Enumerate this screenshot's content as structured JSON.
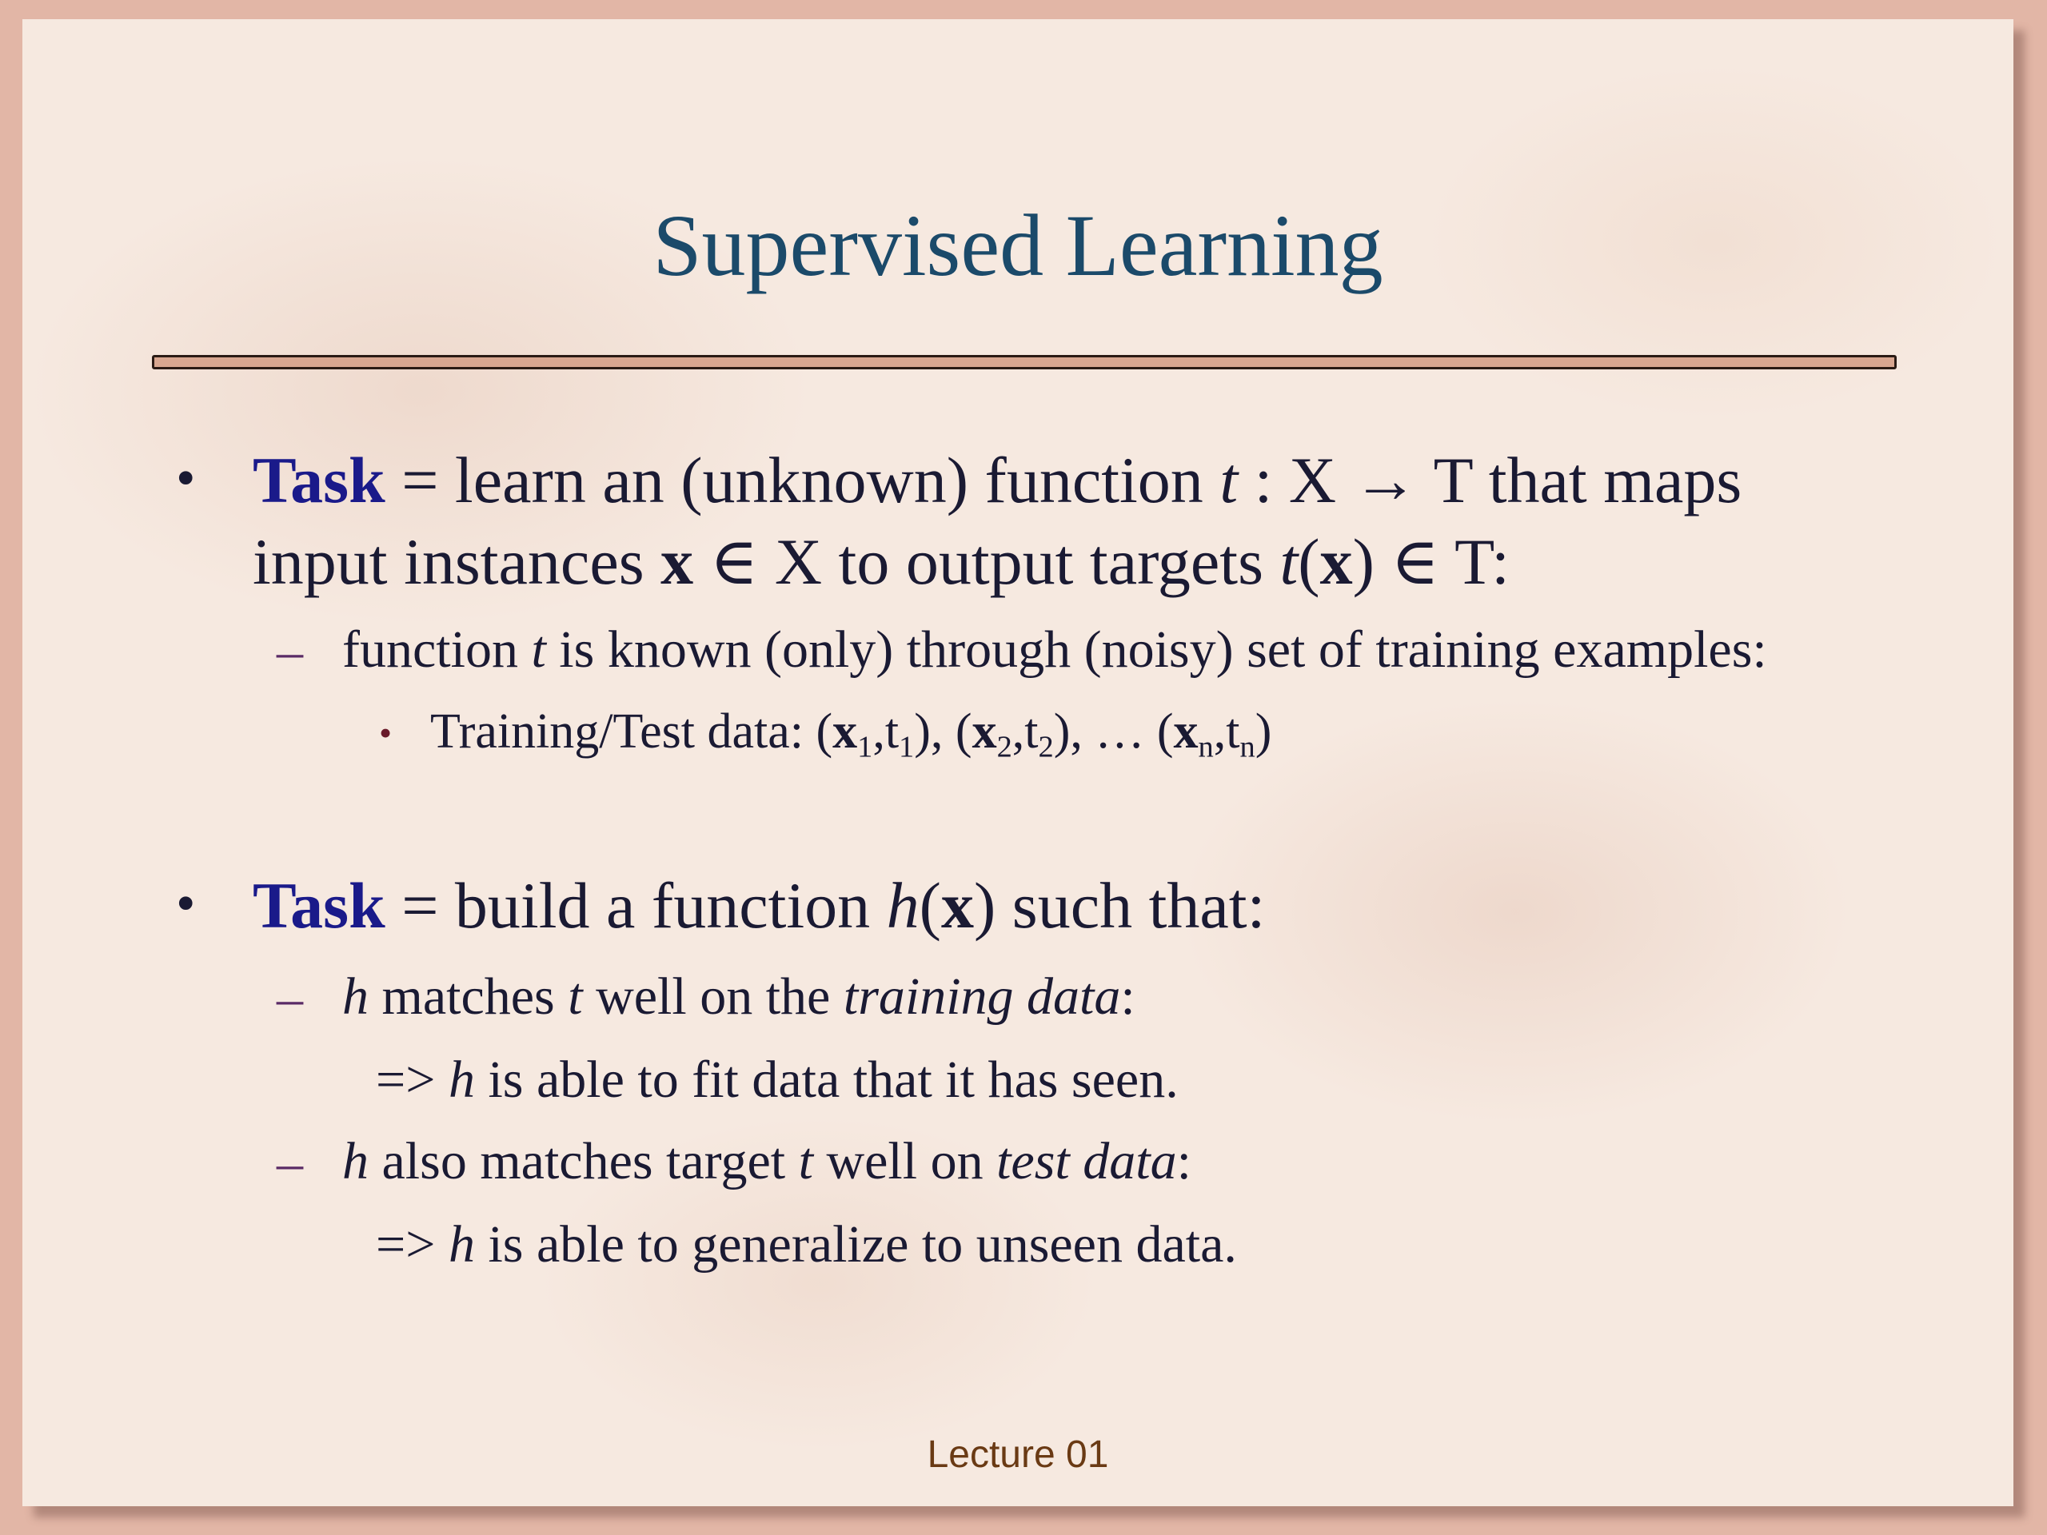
{
  "slide": {
    "title": "Supervised Learning",
    "footer": "Lecture 01",
    "bullet_glyph": "•",
    "dash_glyph": "–",
    "small_bullet_glyph": "•",
    "block1": {
      "keyword": "Task",
      "l1_a": " = learn an (unknown) function ",
      "l1_t": "t",
      "l1_b": " : X ",
      "arrow": "→",
      "l1_c": " T that maps",
      "l2_a": "input instances ",
      "l2_x": "x",
      "l2_in1": " ∈ ",
      "l2_b": "X to output targets ",
      "l2_t": "t",
      "l2_paren_open": "(",
      "l2_x2": "x",
      "l2_paren_close": ")",
      "l2_in2": " ∈ ",
      "l2_c": "T:",
      "sub1_a": "function ",
      "sub1_t": "t",
      "sub1_b": "  is known (only) through (noisy) set of training examples:",
      "sub2_a": "Training/Test data: (",
      "x": "x",
      "s1": "1",
      "comma_t": ",t",
      "s1b": "1",
      "mid1": "), (",
      "s2": "2",
      "s2b": "2",
      "mid2": "), … (",
      "sn": "n",
      "snb": "n",
      "end": ")"
    },
    "block2": {
      "keyword": "Task",
      "l1_a": " = build a function ",
      "l1_h": "h",
      "l1_po": "(",
      "l1_x": "x",
      "l1_pc": ")",
      "l1_b": " such that:",
      "d1_h": "h",
      "d1_a": " matches ",
      "d1_t": "t",
      "d1_b": " well on the ",
      "d1_td": "training data",
      "d1_c": ":",
      "r1_a": "=> ",
      "r1_h": "h",
      "r1_b": " is able to fit data that it has seen.",
      "d2_h": "h",
      "d2_a": " also matches target ",
      "d2_t": "t",
      "d2_b": " well on ",
      "d2_td": "test data",
      "d2_c": ":",
      "r2_a": "=> ",
      "r2_h": "h",
      "r2_b": " is able to generalize to unseen data."
    }
  }
}
